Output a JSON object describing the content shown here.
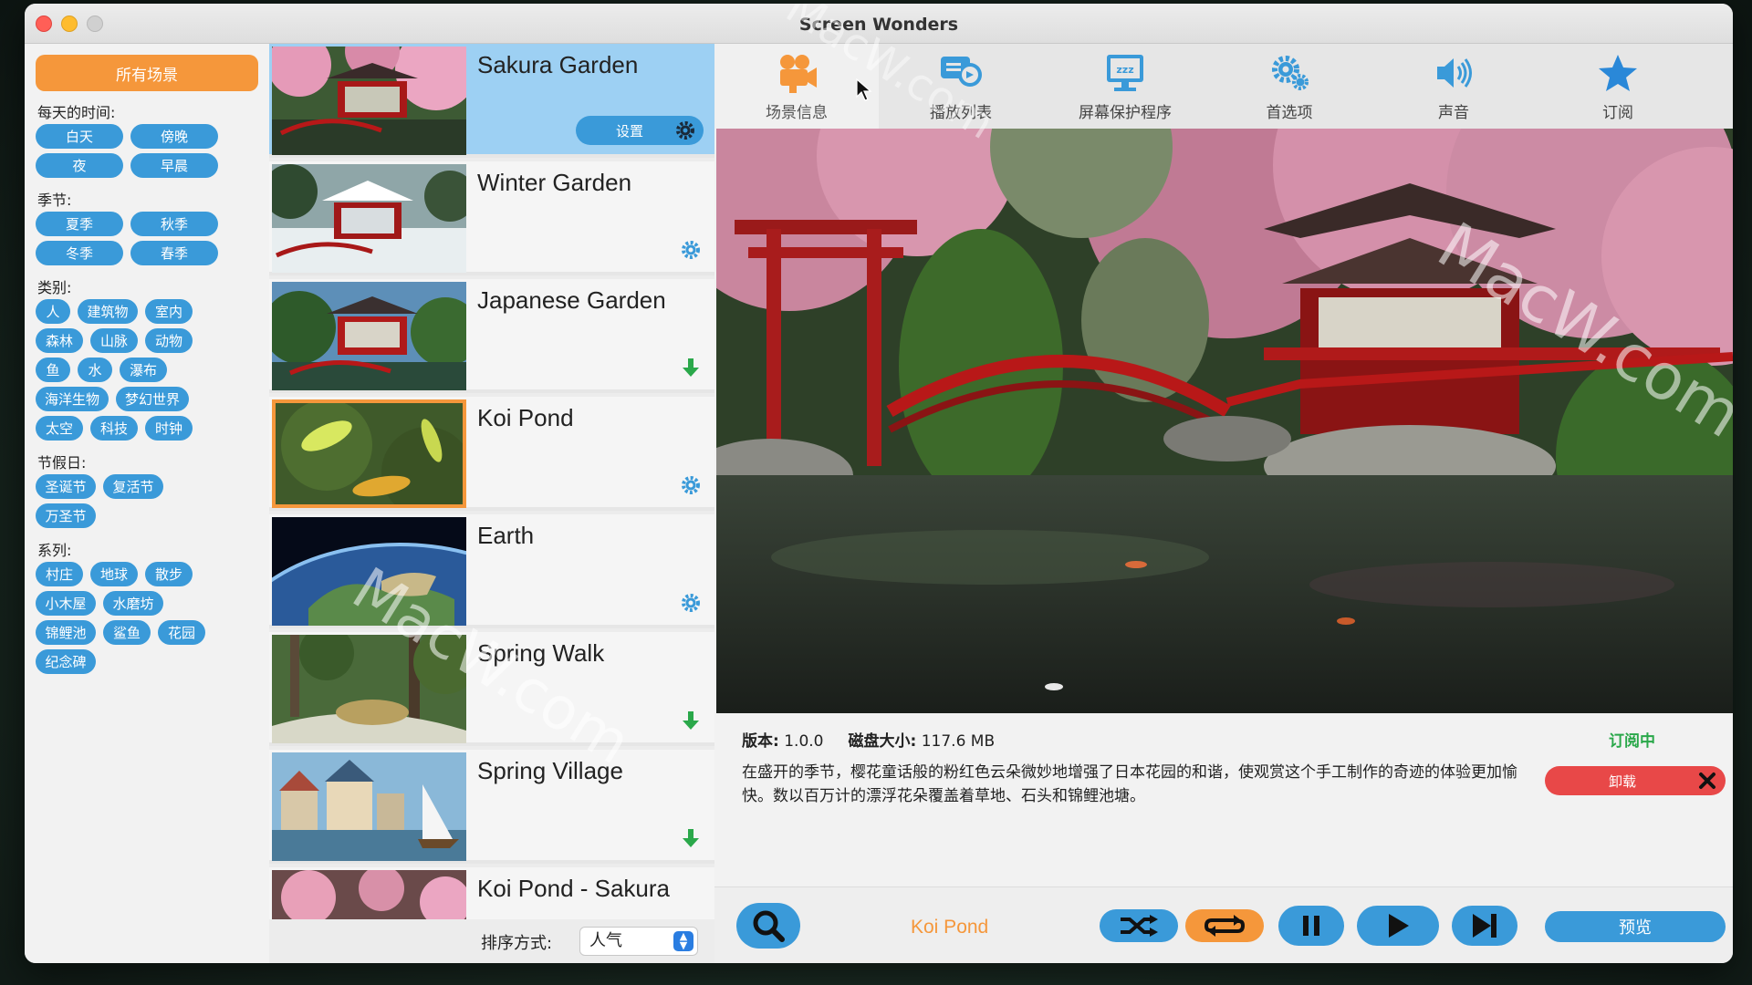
{
  "window": {
    "title": "Screen Wonders"
  },
  "sidebar": {
    "all_scenes": "所有场景",
    "sections": [
      {
        "label": "每天的时间:",
        "tags": [
          "白天",
          "傍晚",
          "夜",
          "早晨"
        ]
      },
      {
        "label": "季节:",
        "tags": [
          "夏季",
          "秋季",
          "冬季",
          "春季"
        ]
      },
      {
        "label": "类别:",
        "tags": [
          "人",
          "建筑物",
          "室内",
          "森林",
          "山脉",
          "动物",
          "鱼",
          "水",
          "瀑布",
          "海洋生物",
          "梦幻世界",
          "太空",
          "科技",
          "时钟"
        ]
      },
      {
        "label": "节假日:",
        "tags": [
          "圣诞节",
          "复活节",
          "万圣节"
        ]
      },
      {
        "label": "系列:",
        "tags": [
          "村庄",
          "地球",
          "散步",
          "小木屋",
          "水磨坊",
          "锦鲤池",
          "鲨鱼",
          "花园",
          "纪念碑"
        ]
      }
    ]
  },
  "scenes": [
    {
      "title": "Sakura Garden",
      "action": "settings",
      "settings_label": "设置",
      "selected": true
    },
    {
      "title": "Winter Garden",
      "action": "settings"
    },
    {
      "title": "Japanese Garden",
      "action": "download"
    },
    {
      "title": "Koi Pond",
      "action": "settings",
      "highlighted": true
    },
    {
      "title": "Earth",
      "action": "settings"
    },
    {
      "title": "Spring Walk",
      "action": "download"
    },
    {
      "title": "Spring Village",
      "action": "download"
    },
    {
      "title": "Koi Pond - Sakura",
      "action": ""
    }
  ],
  "sort": {
    "label": "排序方式:",
    "value": "人气"
  },
  "tabs": [
    {
      "label": "场景信息",
      "icon": "camera-icon"
    },
    {
      "label": "播放列表",
      "icon": "playlist-icon"
    },
    {
      "label": "屏幕保护程序",
      "icon": "screensaver-icon"
    },
    {
      "label": "首选项",
      "icon": "gears-icon"
    },
    {
      "label": "声音",
      "icon": "speaker-icon"
    },
    {
      "label": "订阅",
      "icon": "star-icon"
    }
  ],
  "info": {
    "version_label": "版本:",
    "version": "1.0.0",
    "disk_label": "磁盘大小:",
    "disk_size": "117.6 MB",
    "status": "订阅中",
    "description": "在盛开的季节，樱花童话般的粉红色云朵微妙地增强了日本花园的和谐，使观赏这个手工制作的奇迹的体验更加愉快。数以百万计的漂浮花朵覆盖着草地、石头和锦鲤池塘。",
    "uninstall": "卸载"
  },
  "player": {
    "now_playing": "Koi Pond",
    "preview": "预览"
  },
  "watermark": {
    "text": "MacW.com"
  },
  "colors": {
    "accent_orange": "#f5973b",
    "accent_blue": "#3a9ad9",
    "green": "#2aa84a",
    "red": "#e84848",
    "selected_row": "#9dd0f3"
  }
}
